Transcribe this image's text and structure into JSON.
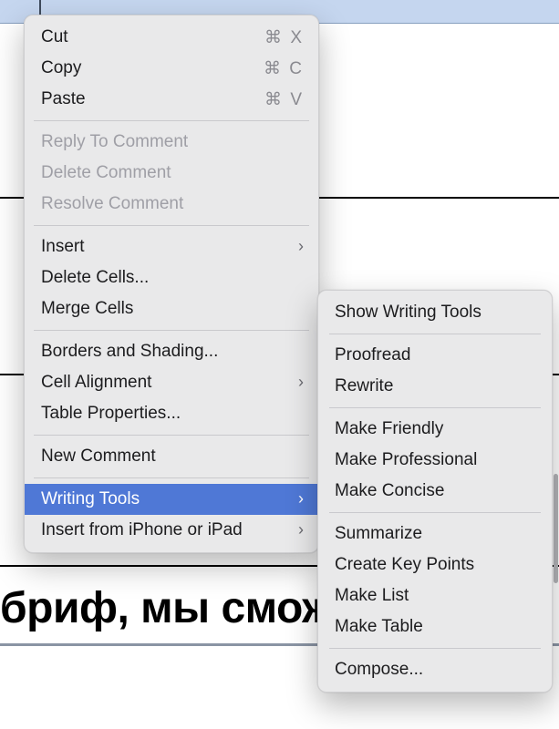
{
  "background": {
    "partial_text": "бриф, мы смож"
  },
  "menu": {
    "groups": [
      {
        "items": [
          {
            "label": "Cut",
            "shortcut": "⌘ X",
            "enabled": true
          },
          {
            "label": "Copy",
            "shortcut": "⌘ C",
            "enabled": true
          },
          {
            "label": "Paste",
            "shortcut": "⌘ V",
            "enabled": true
          }
        ]
      },
      {
        "items": [
          {
            "label": "Reply To Comment",
            "enabled": false
          },
          {
            "label": "Delete Comment",
            "enabled": false
          },
          {
            "label": "Resolve Comment",
            "enabled": false
          }
        ]
      },
      {
        "items": [
          {
            "label": "Insert",
            "submenu": true,
            "enabled": true
          },
          {
            "label": "Delete Cells...",
            "enabled": true
          },
          {
            "label": "Merge Cells",
            "enabled": true
          }
        ]
      },
      {
        "items": [
          {
            "label": "Borders and Shading...",
            "enabled": true
          },
          {
            "label": "Cell Alignment",
            "submenu": true,
            "enabled": true
          },
          {
            "label": "Table Properties...",
            "enabled": true
          }
        ]
      },
      {
        "items": [
          {
            "label": "New Comment",
            "enabled": true
          }
        ]
      },
      {
        "items": [
          {
            "label": "Writing Tools",
            "submenu": true,
            "enabled": true,
            "selected": true
          },
          {
            "label": "Insert from iPhone or iPad",
            "submenu": true,
            "enabled": true
          }
        ]
      }
    ]
  },
  "submenu": {
    "title": "Writing Tools",
    "groups": [
      {
        "items": [
          {
            "label": "Show Writing Tools"
          }
        ]
      },
      {
        "items": [
          {
            "label": "Proofread"
          },
          {
            "label": "Rewrite"
          }
        ]
      },
      {
        "items": [
          {
            "label": "Make Friendly"
          },
          {
            "label": "Make Professional"
          },
          {
            "label": "Make Concise"
          }
        ]
      },
      {
        "items": [
          {
            "label": "Summarize"
          },
          {
            "label": "Create Key Points"
          },
          {
            "label": "Make List"
          },
          {
            "label": "Make Table"
          }
        ]
      },
      {
        "items": [
          {
            "label": "Compose..."
          }
        ]
      }
    ]
  }
}
